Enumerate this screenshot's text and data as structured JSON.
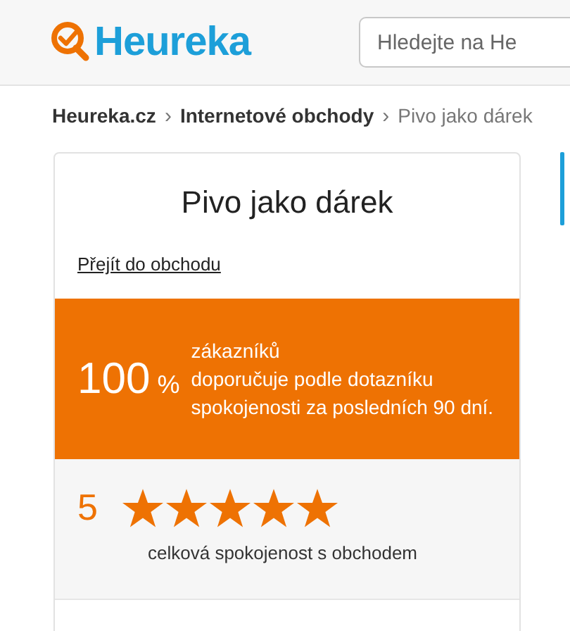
{
  "header": {
    "logo": "Heureka",
    "search": {
      "placeholder": "Hledejte na He"
    }
  },
  "breadcrumb": [
    {
      "label": "Heureka.cz",
      "current": false
    },
    {
      "label": "Internetové obchody",
      "current": false
    },
    {
      "label": "Pivo jako dárek",
      "current": true
    }
  ],
  "breadcrumb_separator": "›",
  "shop": {
    "name": "Pivo jako dárek",
    "link": "Přejít do obchodu",
    "recommendation": {
      "value": "100",
      "unit": "%",
      "text": "zákazníků\ndoporučuje podle dotazníku spokojenosti za posledních 90 dní."
    },
    "rating": {
      "score": "5",
      "stars": 5,
      "label": "celková spokojenost s obchodem"
    }
  }
}
